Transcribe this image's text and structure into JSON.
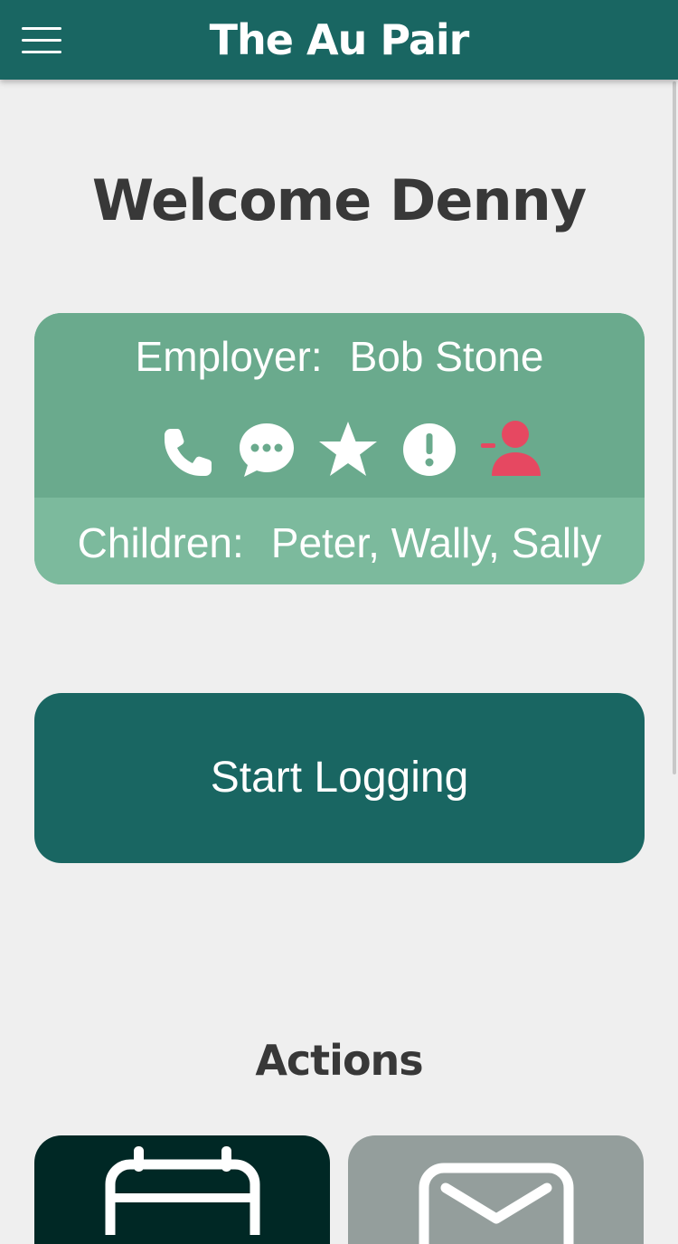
{
  "app_bar": {
    "title": "The Au Pair",
    "menu_icon": "hamburger-menu-icon",
    "background": "#196662"
  },
  "welcome": {
    "text": "Welcome Denny"
  },
  "family_card": {
    "employer_label": "Employer:",
    "employer_name": "Bob Stone",
    "children_label": "Children:",
    "children_names": "Peter, Wally, Sally",
    "icons": [
      "phone-icon",
      "chat-icon",
      "star-icon",
      "alert-icon",
      "remove-user-icon"
    ],
    "accent_color": "#e64861",
    "top_color": "#6aaa8d",
    "bottom_color": "#7cba9d"
  },
  "start_button": {
    "label": "Start Logging",
    "background": "#196662"
  },
  "actions": {
    "title": "Actions",
    "tiles": [
      {
        "icon": "calendar-icon",
        "background": "#002825"
      },
      {
        "icon": "mail-icon",
        "background": "#949e9c"
      }
    ]
  }
}
